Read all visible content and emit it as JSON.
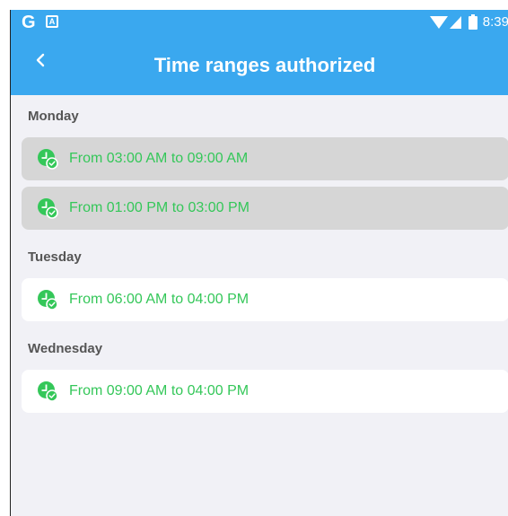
{
  "status_bar": {
    "g_letter": "G",
    "a_letter": "A",
    "time": "8:39"
  },
  "header": {
    "title": "Time ranges authorized"
  },
  "days": [
    {
      "name": "Monday",
      "ranges": [
        {
          "label": "From 03:00 AM to 09:00 AM",
          "selected": true
        },
        {
          "label": "From 01:00 PM to 03:00 PM",
          "selected": true
        }
      ]
    },
    {
      "name": "Tuesday",
      "ranges": [
        {
          "label": "From 06:00 AM to 04:00 PM",
          "selected": false
        }
      ]
    },
    {
      "name": "Wednesday",
      "ranges": [
        {
          "label": "From 09:00 AM to 04:00 PM",
          "selected": false
        }
      ]
    }
  ],
  "colors": {
    "appbar": "#3aa8ef",
    "accent_green": "#34c759",
    "selected_bg": "#d6d6d6",
    "background": "#f1f1f6"
  },
  "icons": {
    "back": "chevron-left-icon",
    "range": "clock-check-icon"
  }
}
